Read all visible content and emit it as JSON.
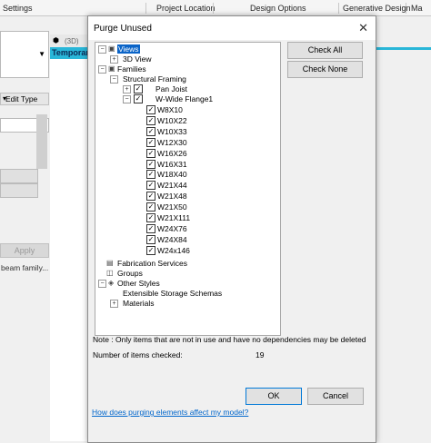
{
  "ribbon": {
    "settings": "Settings",
    "project_location": "Project Location",
    "design_options": "Design Options",
    "generative_design": "Generative Design",
    "mass": "Ma"
  },
  "background": {
    "view_tab": "(3D)",
    "temp_label": "Temporar",
    "edit_type": "Edit Type",
    "apply": "Apply",
    "family_text": "beam family..."
  },
  "dialog": {
    "title": "Purge Unused",
    "close_glyph": "✕",
    "check_all": "Check All",
    "check_none": "Check None",
    "note": "Note : Only items that are not in use and have no dependencies may be deleted",
    "items_checked_label": "Number of items checked:",
    "items_checked_value": "19",
    "ok": "OK",
    "cancel": "Cancel",
    "help_link": "How does purging elements affect my model?"
  },
  "tree": {
    "views": "Views",
    "view_3d": "3D View",
    "families": "Families",
    "structural_framing": "Structural Framing",
    "pan_joist": "Pan Joist",
    "w_wide_flange": "W-Wide Flange1",
    "sizes": [
      "W8X10",
      "W10X22",
      "W10X33",
      "W12X30",
      "W16X26",
      "W16X31",
      "W18X40",
      "W21X44",
      "W21X48",
      "W21X50",
      "W21X111",
      "W24X76",
      "W24X84",
      "W24x146"
    ],
    "fabrication_services": "Fabrication Services",
    "groups": "Groups",
    "other_styles": "Other Styles",
    "extensible_storage": "Extensible Storage Schemas",
    "materials": "Materials"
  },
  "icons": {
    "check": "✓",
    "minus": "−",
    "plus": "+"
  }
}
